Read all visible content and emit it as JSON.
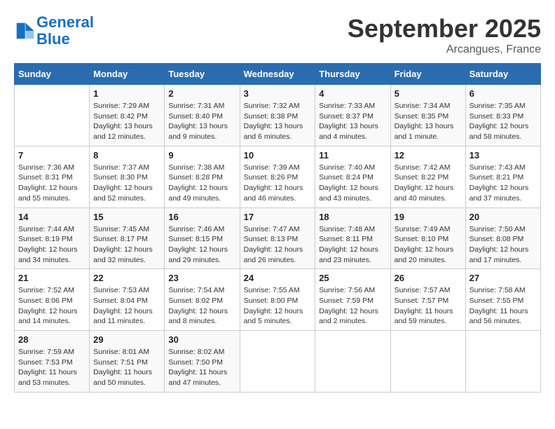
{
  "header": {
    "logo_line1": "General",
    "logo_line2": "Blue",
    "month_year": "September 2025",
    "location": "Arcangues, France"
  },
  "days_of_week": [
    "Sunday",
    "Monday",
    "Tuesday",
    "Wednesday",
    "Thursday",
    "Friday",
    "Saturday"
  ],
  "weeks": [
    [
      {
        "day": "",
        "info": ""
      },
      {
        "day": "1",
        "info": "Sunrise: 7:29 AM\nSunset: 8:42 PM\nDaylight: 13 hours\nand 12 minutes."
      },
      {
        "day": "2",
        "info": "Sunrise: 7:31 AM\nSunset: 8:40 PM\nDaylight: 13 hours\nand 9 minutes."
      },
      {
        "day": "3",
        "info": "Sunrise: 7:32 AM\nSunset: 8:38 PM\nDaylight: 13 hours\nand 6 minutes."
      },
      {
        "day": "4",
        "info": "Sunrise: 7:33 AM\nSunset: 8:37 PM\nDaylight: 13 hours\nand 4 minutes."
      },
      {
        "day": "5",
        "info": "Sunrise: 7:34 AM\nSunset: 8:35 PM\nDaylight: 13 hours\nand 1 minute."
      },
      {
        "day": "6",
        "info": "Sunrise: 7:35 AM\nSunset: 8:33 PM\nDaylight: 12 hours\nand 58 minutes."
      }
    ],
    [
      {
        "day": "7",
        "info": "Sunrise: 7:36 AM\nSunset: 8:31 PM\nDaylight: 12 hours\nand 55 minutes."
      },
      {
        "day": "8",
        "info": "Sunrise: 7:37 AM\nSunset: 8:30 PM\nDaylight: 12 hours\nand 52 minutes."
      },
      {
        "day": "9",
        "info": "Sunrise: 7:38 AM\nSunset: 8:28 PM\nDaylight: 12 hours\nand 49 minutes."
      },
      {
        "day": "10",
        "info": "Sunrise: 7:39 AM\nSunset: 8:26 PM\nDaylight: 12 hours\nand 46 minutes."
      },
      {
        "day": "11",
        "info": "Sunrise: 7:40 AM\nSunset: 8:24 PM\nDaylight: 12 hours\nand 43 minutes."
      },
      {
        "day": "12",
        "info": "Sunrise: 7:42 AM\nSunset: 8:22 PM\nDaylight: 12 hours\nand 40 minutes."
      },
      {
        "day": "13",
        "info": "Sunrise: 7:43 AM\nSunset: 8:21 PM\nDaylight: 12 hours\nand 37 minutes."
      }
    ],
    [
      {
        "day": "14",
        "info": "Sunrise: 7:44 AM\nSunset: 8:19 PM\nDaylight: 12 hours\nand 34 minutes."
      },
      {
        "day": "15",
        "info": "Sunrise: 7:45 AM\nSunset: 8:17 PM\nDaylight: 12 hours\nand 32 minutes."
      },
      {
        "day": "16",
        "info": "Sunrise: 7:46 AM\nSunset: 8:15 PM\nDaylight: 12 hours\nand 29 minutes."
      },
      {
        "day": "17",
        "info": "Sunrise: 7:47 AM\nSunset: 8:13 PM\nDaylight: 12 hours\nand 26 minutes."
      },
      {
        "day": "18",
        "info": "Sunrise: 7:48 AM\nSunset: 8:11 PM\nDaylight: 12 hours\nand 23 minutes."
      },
      {
        "day": "19",
        "info": "Sunrise: 7:49 AM\nSunset: 8:10 PM\nDaylight: 12 hours\nand 20 minutes."
      },
      {
        "day": "20",
        "info": "Sunrise: 7:50 AM\nSunset: 8:08 PM\nDaylight: 12 hours\nand 17 minutes."
      }
    ],
    [
      {
        "day": "21",
        "info": "Sunrise: 7:52 AM\nSunset: 8:06 PM\nDaylight: 12 hours\nand 14 minutes."
      },
      {
        "day": "22",
        "info": "Sunrise: 7:53 AM\nSunset: 8:04 PM\nDaylight: 12 hours\nand 11 minutes."
      },
      {
        "day": "23",
        "info": "Sunrise: 7:54 AM\nSunset: 8:02 PM\nDaylight: 12 hours\nand 8 minutes."
      },
      {
        "day": "24",
        "info": "Sunrise: 7:55 AM\nSunset: 8:00 PM\nDaylight: 12 hours\nand 5 minutes."
      },
      {
        "day": "25",
        "info": "Sunrise: 7:56 AM\nSunset: 7:59 PM\nDaylight: 12 hours\nand 2 minutes."
      },
      {
        "day": "26",
        "info": "Sunrise: 7:57 AM\nSunset: 7:57 PM\nDaylight: 11 hours\nand 59 minutes."
      },
      {
        "day": "27",
        "info": "Sunrise: 7:58 AM\nSunset: 7:55 PM\nDaylight: 11 hours\nand 56 minutes."
      }
    ],
    [
      {
        "day": "28",
        "info": "Sunrise: 7:59 AM\nSunset: 7:53 PM\nDaylight: 11 hours\nand 53 minutes."
      },
      {
        "day": "29",
        "info": "Sunrise: 8:01 AM\nSunset: 7:51 PM\nDaylight: 11 hours\nand 50 minutes."
      },
      {
        "day": "30",
        "info": "Sunrise: 8:02 AM\nSunset: 7:50 PM\nDaylight: 11 hours\nand 47 minutes."
      },
      {
        "day": "",
        "info": ""
      },
      {
        "day": "",
        "info": ""
      },
      {
        "day": "",
        "info": ""
      },
      {
        "day": "",
        "info": ""
      }
    ]
  ]
}
